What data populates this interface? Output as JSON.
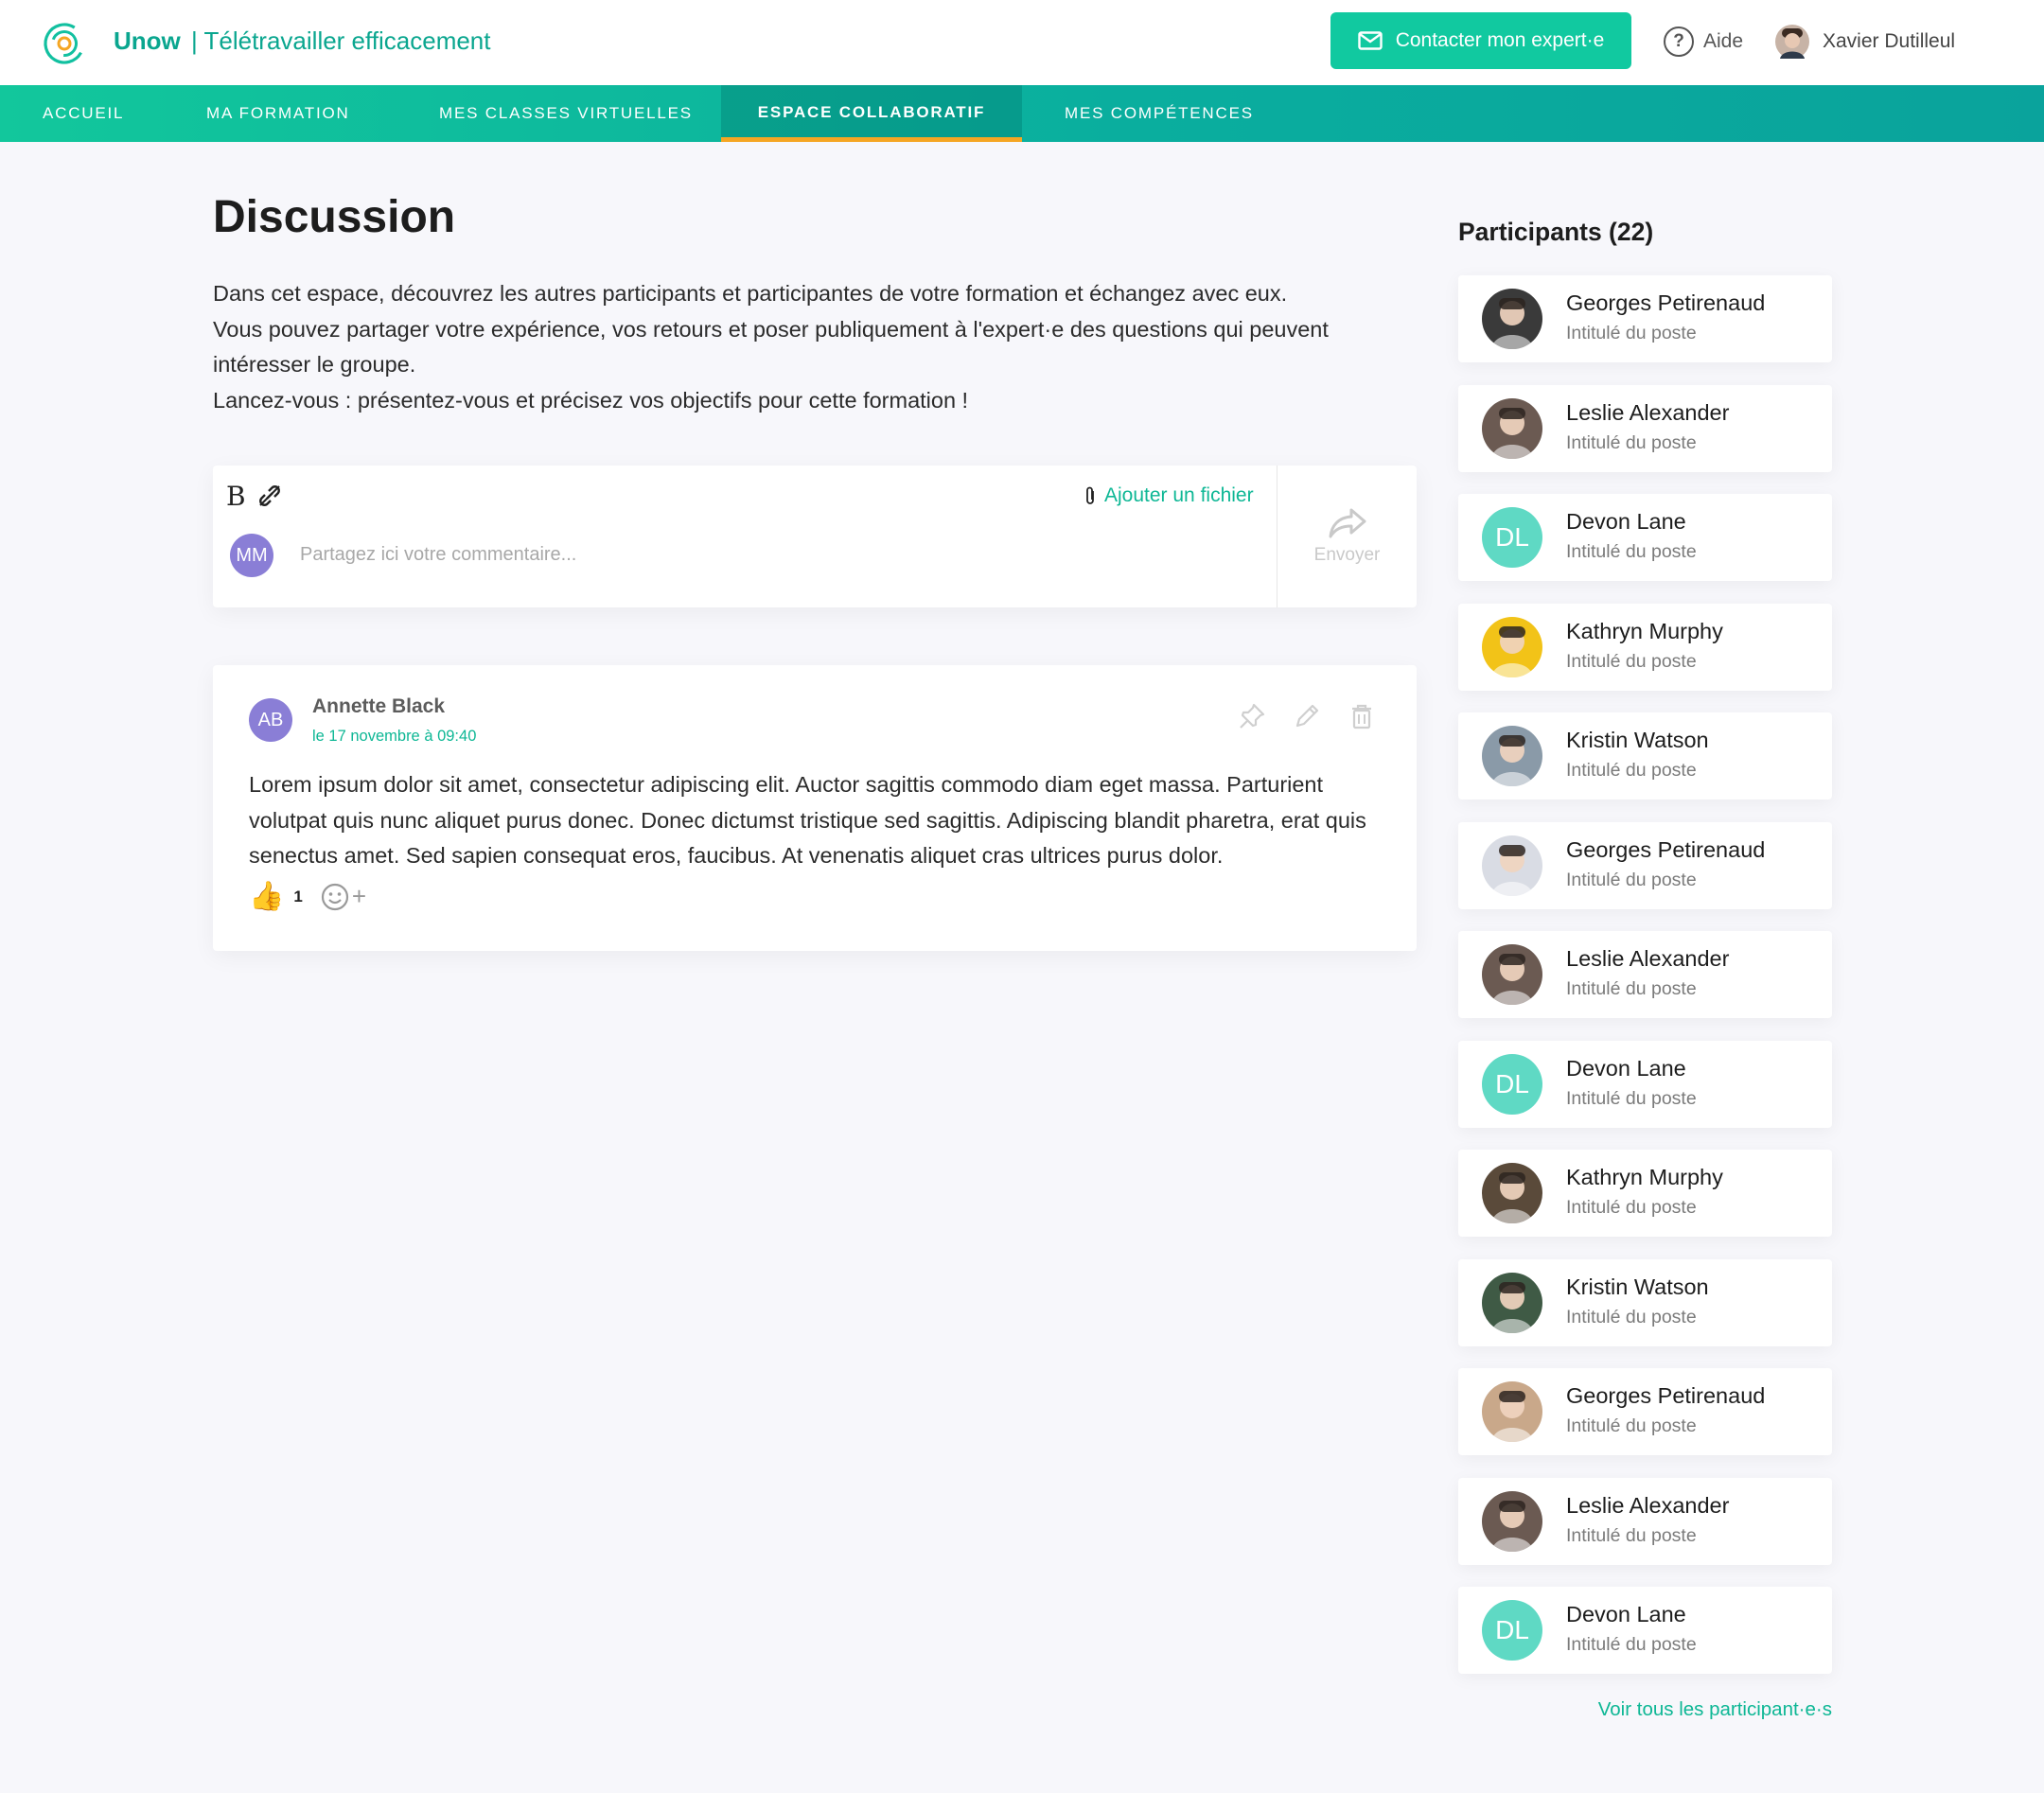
{
  "header": {
    "brand": "Unow",
    "course_title": "| Télétravailler efficacement",
    "contact_button": "Contacter mon expert·e",
    "help_label": "Aide",
    "help_symbol": "?",
    "user_name": "Xavier Dutilleul"
  },
  "nav": {
    "items": [
      {
        "label": "ACCUEIL"
      },
      {
        "label": "MA FORMATION"
      },
      {
        "label": "MES CLASSES VIRTUELLES"
      },
      {
        "label": "ESPACE COLLABORATIF"
      },
      {
        "label": "MES COMPÉTENCES"
      }
    ],
    "active": "ESPACE COLLABORATIF"
  },
  "main": {
    "title": "Discussion",
    "intro": [
      "Dans cet espace, découvrez les autres participants et participantes de votre formation et échangez avec eux.",
      "Vous pouvez partager votre expérience, vos retours et poser publiquement à l'expert·e des questions qui peuvent intéresser le groupe.",
      "Lancez-vous : présentez-vous et précisez vos objectifs pour cette formation !"
    ],
    "composer": {
      "bold_tool": "B",
      "attach_label": "Ajouter un fichier",
      "avatar_initials": "MM",
      "placeholder": "Partagez ici votre commentaire...",
      "send_label": "Envoyer"
    },
    "post": {
      "avatar_initials": "AB",
      "author": "Annette Black",
      "date": "le 17 novembre à 09:40",
      "body": "Lorem ipsum dolor sit amet, consectetur adipiscing elit. Auctor sagittis commodo diam eget massa. Parturient volutpat quis nunc aliquet purus donec. Donec dictumst tristique sed sagittis. Adipiscing blandit pharetra, erat quis senectus amet. Sed sapien consequat eros, faucibus. At venenatis aliquet cras ultrices purus dolor.",
      "reaction_emoji": "👍",
      "reaction_count": "1",
      "add_reaction_plus": "+"
    }
  },
  "sidebar": {
    "title": "Participants (22)",
    "participants": [
      {
        "name": "Georges Petirenaud",
        "role": "Intitulé du poste",
        "initials": "",
        "avatar_color": "#3a3a3a"
      },
      {
        "name": "Leslie Alexander",
        "role": "Intitulé du poste",
        "initials": "",
        "avatar_color": "#6b5a52"
      },
      {
        "name": "Devon Lane",
        "role": "Intitulé du poste",
        "initials": "DL",
        "avatar_color": "#5fd9c4"
      },
      {
        "name": "Kathryn Murphy",
        "role": "Intitulé du poste",
        "initials": "",
        "avatar_color": "#f2c318"
      },
      {
        "name": "Kristin Watson",
        "role": "Intitulé du poste",
        "initials": "",
        "avatar_color": "#8a9aa8"
      },
      {
        "name": "Georges Petirenaud",
        "role": "Intitulé du poste",
        "initials": "",
        "avatar_color": "#d9dce4"
      },
      {
        "name": "Leslie Alexander",
        "role": "Intitulé du poste",
        "initials": "",
        "avatar_color": "#6b5a52"
      },
      {
        "name": "Devon Lane",
        "role": "Intitulé du poste",
        "initials": "DL",
        "avatar_color": "#5fd9c4"
      },
      {
        "name": "Kathryn Murphy",
        "role": "Intitulé du poste",
        "initials": "",
        "avatar_color": "#5a4a3a"
      },
      {
        "name": "Kristin Watson",
        "role": "Intitulé du poste",
        "initials": "",
        "avatar_color": "#3f5a45"
      },
      {
        "name": "Georges Petirenaud",
        "role": "Intitulé du poste",
        "initials": "",
        "avatar_color": "#c9a88a"
      },
      {
        "name": "Leslie Alexander",
        "role": "Intitulé du poste",
        "initials": "",
        "avatar_color": "#6b5a52"
      },
      {
        "name": "Devon Lane",
        "role": "Intitulé du poste",
        "initials": "DL",
        "avatar_color": "#5fd9c4"
      }
    ],
    "see_all": "Voir tous les participant·e·s"
  },
  "colors": {
    "brand": "#0aa68f",
    "accent": "#11c9a0",
    "active_tab_underline": "#f5a623",
    "initials_avatar": "#8a7ed6"
  }
}
